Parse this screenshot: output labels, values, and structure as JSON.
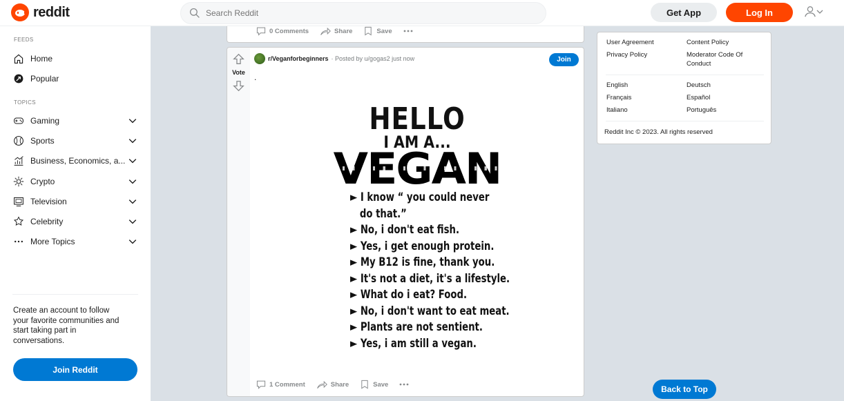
{
  "header": {
    "logo_text": "reddit",
    "search_placeholder": "Search Reddit",
    "get_app_label": "Get App",
    "login_label": "Log In"
  },
  "sidebar": {
    "feeds_label": "FEEDS",
    "feeds": [
      {
        "label": "Home",
        "icon": "home-icon"
      },
      {
        "label": "Popular",
        "icon": "popular-icon"
      }
    ],
    "topics_label": "TOPICS",
    "topics": [
      {
        "label": "Gaming",
        "icon": "gamepad-icon"
      },
      {
        "label": "Sports",
        "icon": "ball-icon"
      },
      {
        "label": "Business, Economics, a...",
        "icon": "chart-icon"
      },
      {
        "label": "Crypto",
        "icon": "crypto-icon"
      },
      {
        "label": "Television",
        "icon": "tv-icon"
      },
      {
        "label": "Celebrity",
        "icon": "star-badge-icon"
      },
      {
        "label": "More Topics",
        "icon": "more-icon"
      }
    ],
    "promo_text": "Create an account to follow your favorite communities and start taking part in conversations.",
    "join_label": "Join Reddit"
  },
  "prev_post": {
    "comments": "0 Comments",
    "share": "Share",
    "save": "Save"
  },
  "post": {
    "vote_label": "Vote",
    "subreddit": "r/Veganforbeginners",
    "posted_by": "· Posted by u/gogas2 just now",
    "join_label": "Join",
    "title": ".",
    "image": {
      "hello": "HELLO",
      "iama": "I AM A...",
      "vegan": "VEGAN",
      "lines": [
        "► I know “ you could never",
        "   do that.”",
        "► No, i don't eat fish.",
        "► Yes, i get enough protein.",
        "► My B12 is fine, thank you.",
        "► It's not a diet, it's a lifestyle.",
        "► What do i eat? Food.",
        "► No, i don't want to eat meat.",
        "► Plants are not sentient.",
        "► Yes, i am still a vegan."
      ]
    },
    "comments": "1 Comment",
    "share": "Share",
    "save": "Save"
  },
  "right": {
    "links_left": [
      "User Agreement",
      "Privacy Policy"
    ],
    "links_right": [
      "Content Policy",
      "Moderator Code Of Conduct"
    ],
    "languages_left": [
      "English",
      "Français",
      "Italiano"
    ],
    "languages_right": [
      "Deutsch",
      "Español",
      "Português"
    ],
    "copyright": "Reddit Inc © 2023. All rights reserved"
  },
  "back_to_top_label": "Back to Top",
  "colors": {
    "brand": "#ff4500",
    "accent": "#0079d3",
    "page_bg": "#dae0e6"
  }
}
